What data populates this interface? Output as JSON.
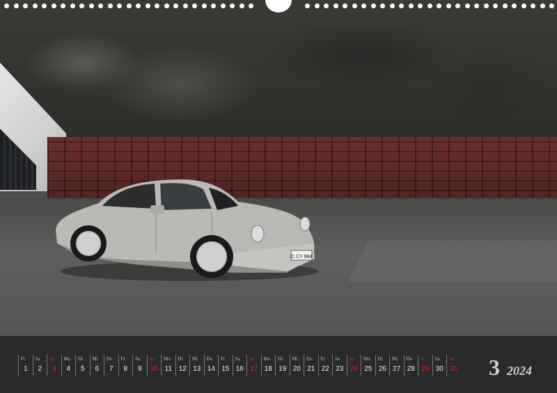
{
  "calendar": {
    "month_number": "3",
    "year": "2024",
    "days": [
      {
        "wd": "Fr",
        "num": "1",
        "hol": false
      },
      {
        "wd": "Sa",
        "num": "2",
        "hol": false
      },
      {
        "wd": "So",
        "num": "3",
        "hol": true
      },
      {
        "wd": "Mo",
        "num": "4",
        "hol": false
      },
      {
        "wd": "Di",
        "num": "5",
        "hol": false
      },
      {
        "wd": "Mi",
        "num": "6",
        "hol": false
      },
      {
        "wd": "Do",
        "num": "7",
        "hol": false
      },
      {
        "wd": "Fr",
        "num": "8",
        "hol": false
      },
      {
        "wd": "Sa",
        "num": "9",
        "hol": false
      },
      {
        "wd": "So",
        "num": "10",
        "hol": true
      },
      {
        "wd": "Mo",
        "num": "11",
        "hol": false
      },
      {
        "wd": "Di",
        "num": "12",
        "hol": false
      },
      {
        "wd": "Mi",
        "num": "13",
        "hol": false
      },
      {
        "wd": "Do",
        "num": "14",
        "hol": false
      },
      {
        "wd": "Fr",
        "num": "15",
        "hol": false
      },
      {
        "wd": "Sa",
        "num": "16",
        "hol": false
      },
      {
        "wd": "So",
        "num": "17",
        "hol": true
      },
      {
        "wd": "Mo",
        "num": "18",
        "hol": false
      },
      {
        "wd": "Di",
        "num": "19",
        "hol": false
      },
      {
        "wd": "Mi",
        "num": "20",
        "hol": false
      },
      {
        "wd": "Do",
        "num": "21",
        "hol": false
      },
      {
        "wd": "Fr",
        "num": "22",
        "hol": false
      },
      {
        "wd": "Sa",
        "num": "23",
        "hol": false
      },
      {
        "wd": "So",
        "num": "24",
        "hol": true
      },
      {
        "wd": "Mo",
        "num": "25",
        "hol": false
      },
      {
        "wd": "Di",
        "num": "26",
        "hol": false
      },
      {
        "wd": "Mi",
        "num": "27",
        "hol": false
      },
      {
        "wd": "Do",
        "num": "28",
        "hol": false
      },
      {
        "wd": "Fr",
        "num": "29",
        "hol": true
      },
      {
        "wd": "Sa",
        "num": "30",
        "hol": false
      },
      {
        "wd": "So",
        "num": "31",
        "hol": true
      }
    ]
  },
  "photo": {
    "license_plate": "C·CY 964"
  },
  "colors": {
    "holiday": "#d8282a",
    "strip": "#2a2a2a",
    "car_silver": "#b9b9b6"
  }
}
